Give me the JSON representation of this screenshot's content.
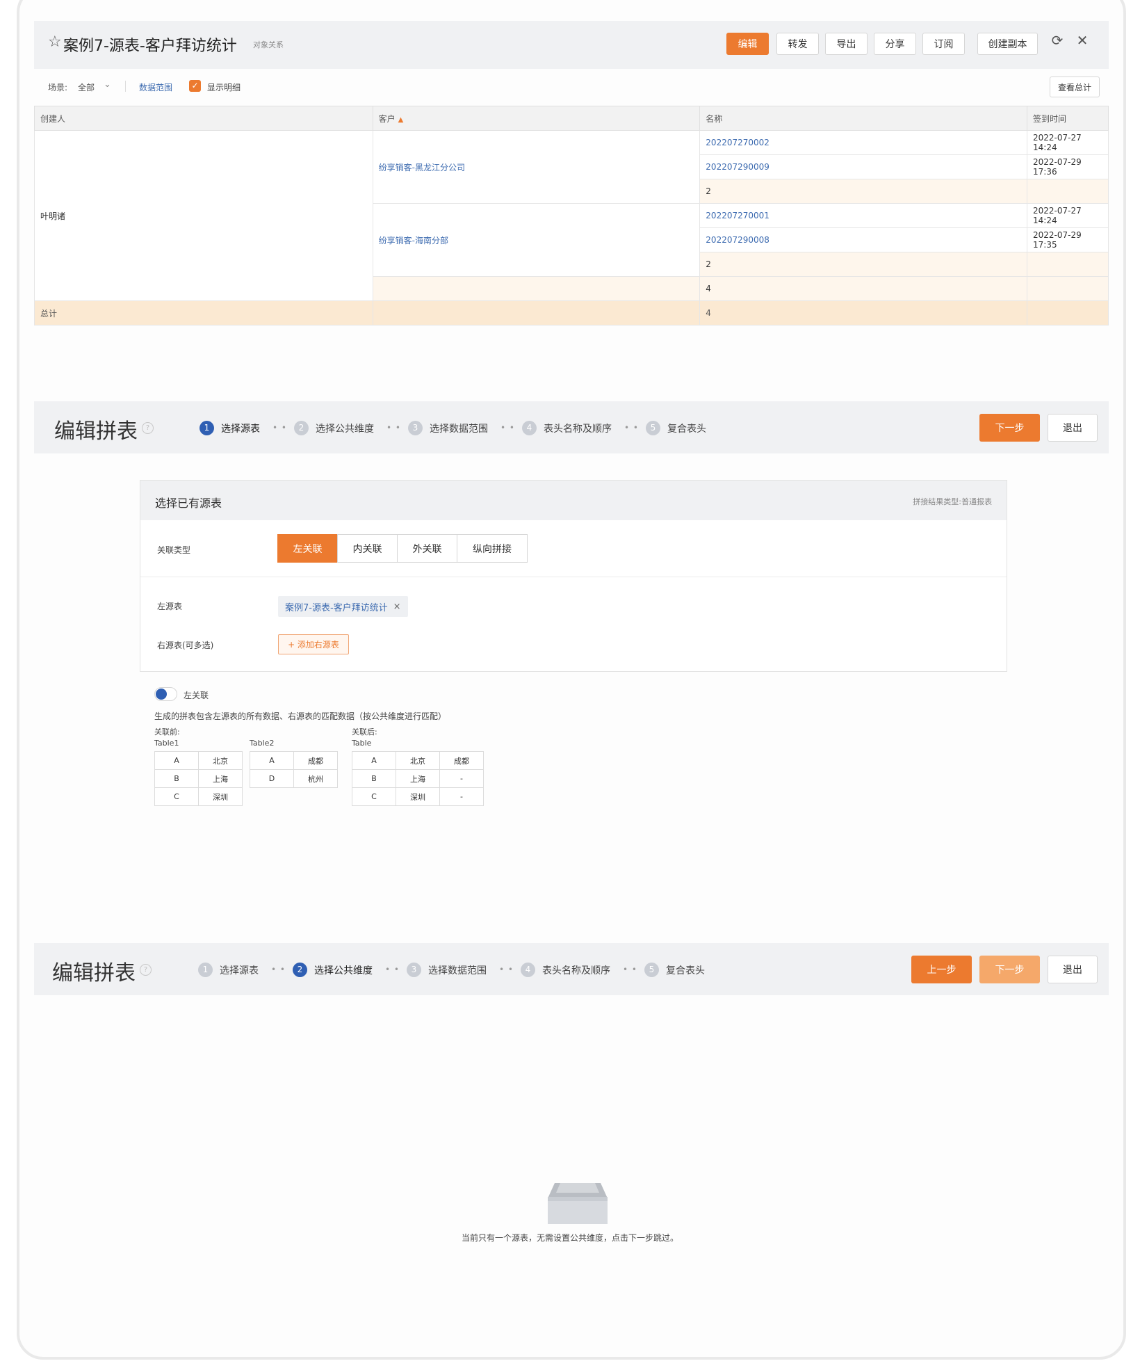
{
  "report": {
    "title": "案例7-源表-客户拜访统计",
    "subtitle": "对象关系",
    "buttons": {
      "edit": "编辑",
      "forward": "转发",
      "export": "导出",
      "share": "分享",
      "subscribe": "订阅",
      "copy": "创建副本"
    },
    "icons": {
      "star": "star-icon",
      "refresh": "refresh-icon",
      "close": "close-icon"
    }
  },
  "filters": {
    "scene_label": "场景:",
    "scene_value": "全部",
    "data_range": "数据范围",
    "show_detail": "显示明细",
    "show_detail_checked": true,
    "view_total": "查看总计"
  },
  "table": {
    "headers": [
      "创建人",
      "客户",
      "名称",
      "签到时间"
    ],
    "creator": "叶明诸",
    "groups": [
      {
        "customer": "纷享销客-黑龙江分公司",
        "rows": [
          {
            "name": "202207270002",
            "time": "2022-07-27 14:24"
          },
          {
            "name": "202207290009",
            "time": "2022-07-29 17:36"
          }
        ],
        "subtotal": "2"
      },
      {
        "customer": "纷享销客-海南分部",
        "rows": [
          {
            "name": "202207270001",
            "time": "2022-07-27 14:24"
          },
          {
            "name": "202207290008",
            "time": "2022-07-29 17:35"
          }
        ],
        "subtotal": "2"
      }
    ],
    "creator_subtotal": "4",
    "total_label": "总计",
    "total_value": "4"
  },
  "wizard1": {
    "title": "编辑拼表",
    "steps": [
      "选择源表",
      "选择公共维度",
      "选择数据范围",
      "表头名称及顺序",
      "复合表头"
    ],
    "step_nums": [
      "1",
      "2",
      "3",
      "4",
      "5"
    ],
    "active_step": 1,
    "next": "下一步",
    "exit": "退出"
  },
  "source_card": {
    "title": "选择已有源表",
    "hint": "拼接结果类型:普通报表",
    "join_type_label": "关联类型",
    "join_types": [
      "左关联",
      "内关联",
      "外关联",
      "纵向拼接"
    ],
    "selected_join": "左关联",
    "left_label": "左源表",
    "left_table": "案例7-源表-客户拜访统计",
    "right_label": "右源表(可多选)",
    "add_right": "+ 添加右源表"
  },
  "join_help": {
    "toggle_label": "左关联",
    "description": "生成的拼表包含左源表的所有数据、右源表的匹配数据（按公共维度进行匹配）",
    "before_label": "关联前:",
    "after_label": "关联后:",
    "table1_name": "Table1",
    "table2_name": "Table2",
    "result_name": "Table",
    "table1": [
      [
        "A",
        "北京"
      ],
      [
        "B",
        "上海"
      ],
      [
        "C",
        "深圳"
      ]
    ],
    "table2": [
      [
        "A",
        "成都"
      ],
      [
        "D",
        "杭州"
      ]
    ],
    "result": [
      [
        "A",
        "北京",
        "成都"
      ],
      [
        "B",
        "上海",
        "-"
      ],
      [
        "C",
        "深圳",
        "-"
      ]
    ]
  },
  "wizard2": {
    "title": "编辑拼表",
    "steps": [
      "选择源表",
      "选择公共维度",
      "选择数据范围",
      "表头名称及顺序",
      "复合表头"
    ],
    "step_nums": [
      "1",
      "2",
      "3",
      "4",
      "5"
    ],
    "active_step": 2,
    "prev": "上一步",
    "next": "下一步",
    "exit": "退出"
  },
  "empty": {
    "message": "当前只有一个源表，无需设置公共维度，点击下一步跳过。"
  }
}
